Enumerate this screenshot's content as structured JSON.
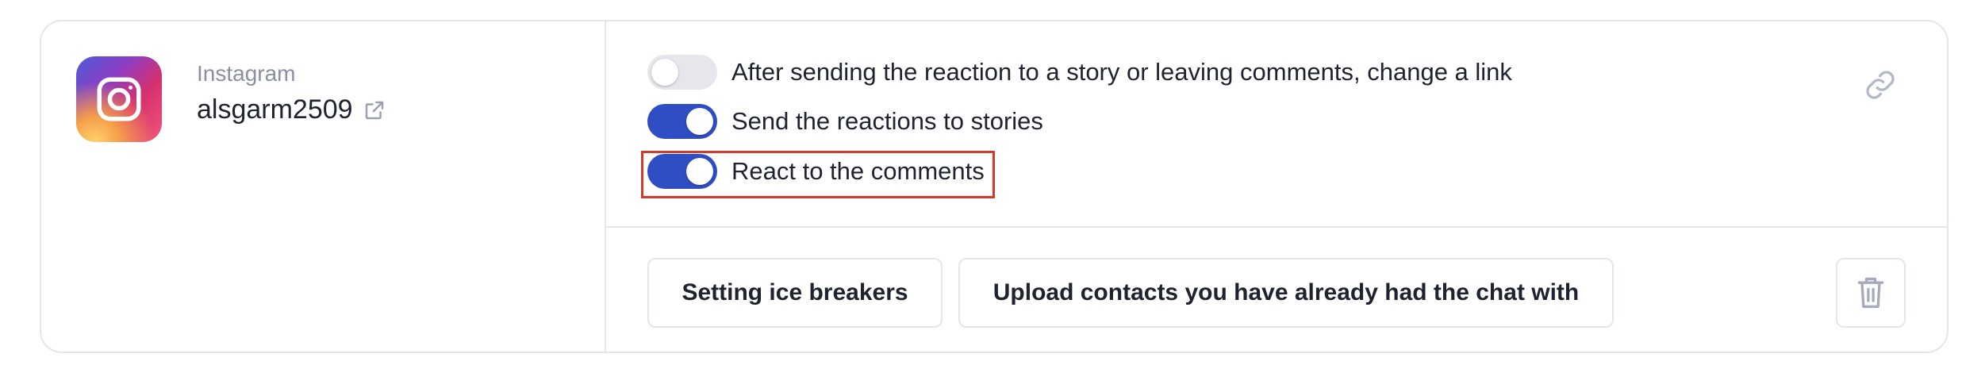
{
  "account": {
    "platform": "Instagram",
    "username": "alsgarm2509",
    "logo_icon": "instagram-logo-icon",
    "external_link_icon": "external-link-icon"
  },
  "settings": {
    "toggles": [
      {
        "label": "After sending the reaction to a story or leaving comments, change a link",
        "enabled": false
      },
      {
        "label": "Send the reactions to stories",
        "enabled": true
      },
      {
        "label": "React to the comments",
        "enabled": true
      }
    ],
    "link_icon": "link-icon",
    "highlighted_toggle": 2
  },
  "actions": {
    "ice_breakers_label": "Setting ice breakers",
    "upload_contacts_label": "Upload contacts you have already had the chat with",
    "delete_icon": "trash-icon"
  },
  "colors": {
    "toggle_on": "#2f4ec4",
    "toggle_off": "#e5e7ec",
    "highlight_border": "#d33b2c",
    "card_border": "#e3e6ec",
    "muted_text": "#8a90a2"
  }
}
